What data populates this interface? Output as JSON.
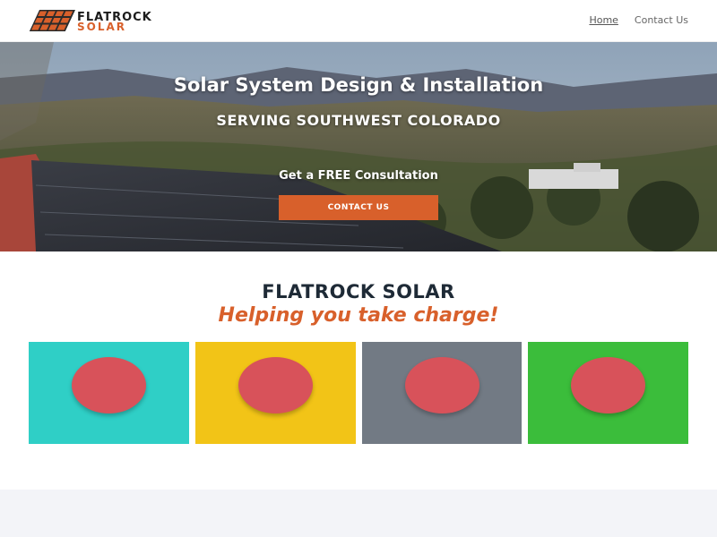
{
  "header": {
    "logo_line1": "FLATROCK",
    "logo_line2": "SOLAR",
    "nav": [
      {
        "label": "Home",
        "active": true
      },
      {
        "label": "Contact Us",
        "active": false
      }
    ]
  },
  "hero": {
    "title": "Solar System Design & Installation",
    "subtitle": "SERVING SOUTHWEST COLORADO",
    "cta_text": "Get a FREE Consultation",
    "button_label": "CONTACT US"
  },
  "section": {
    "title": "FLATROCK SOLAR",
    "tagline": "Helping you take charge!",
    "cards": [
      {
        "color": "#2fcfc6",
        "icon": "circle-placeholder"
      },
      {
        "color": "#f2c417",
        "icon": "circle-placeholder"
      },
      {
        "color": "#727a84",
        "icon": "circle-placeholder"
      },
      {
        "color": "#3bbd3b",
        "icon": "circle-placeholder"
      }
    ]
  },
  "colors": {
    "accent": "#d8602b",
    "dark_text": "#1e2a36",
    "circle": "#d8525a"
  }
}
